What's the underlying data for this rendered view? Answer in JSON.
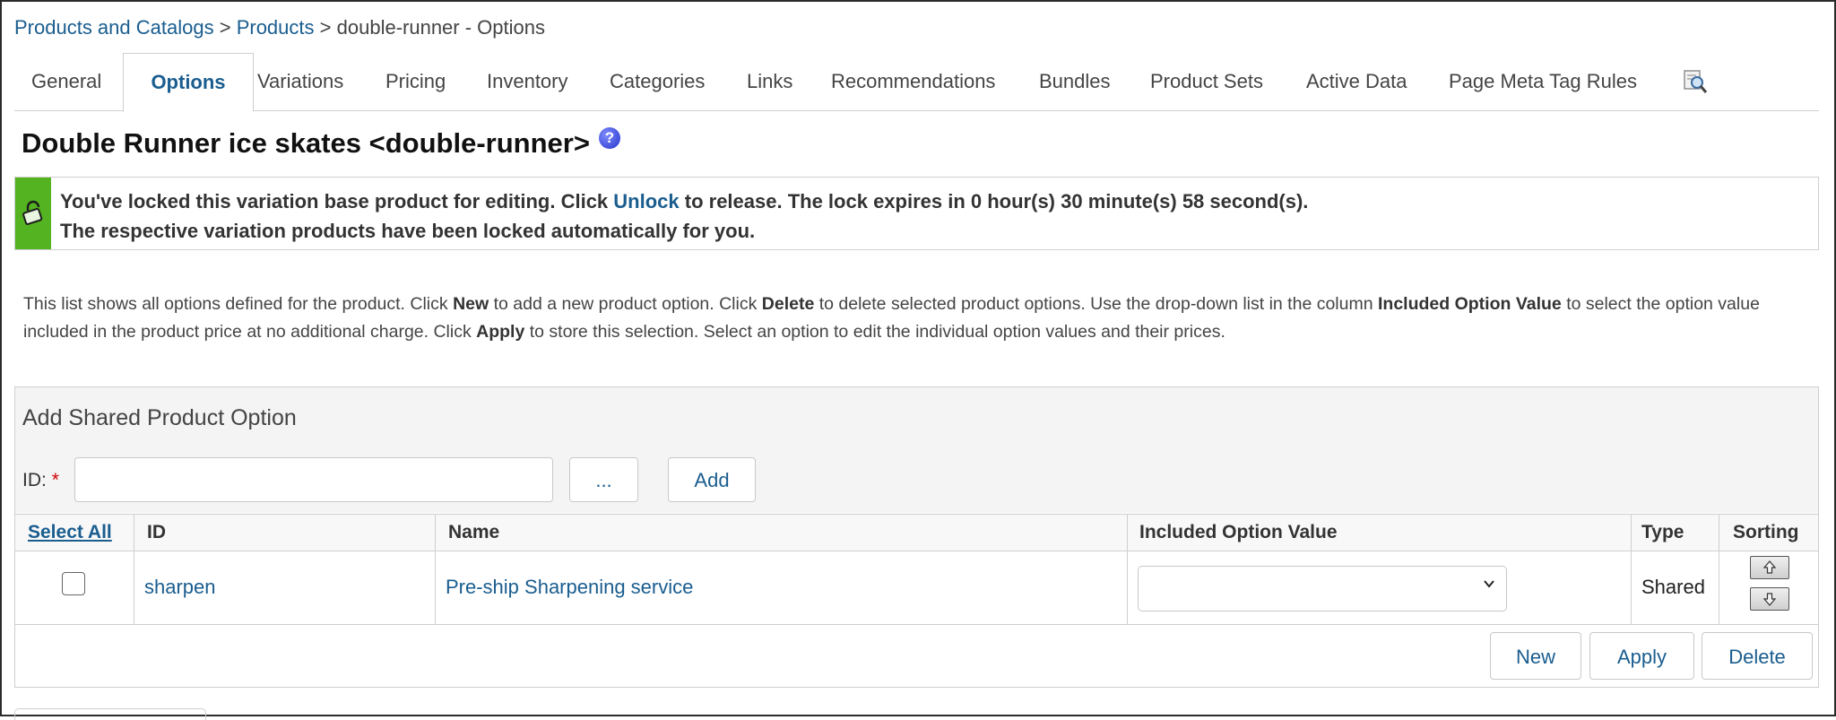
{
  "breadcrumb": {
    "root": "Products and Catalogs",
    "sep1": ">",
    "products": "Products",
    "sep2": ">",
    "current": "double-runner - Options"
  },
  "tabs": [
    {
      "label": "General"
    },
    {
      "label": "Options",
      "active": true
    },
    {
      "label": "Variations"
    },
    {
      "label": "Pricing"
    },
    {
      "label": "Inventory"
    },
    {
      "label": "Categories"
    },
    {
      "label": "Links"
    },
    {
      "label": "Recommendations"
    },
    {
      "label": "Bundles"
    },
    {
      "label": "Product Sets"
    },
    {
      "label": "Active Data"
    },
    {
      "label": "Page Meta Tag Rules"
    }
  ],
  "page": {
    "title": "Double Runner ice skates <double-runner>",
    "help_icon": "?"
  },
  "lock_message": {
    "line1_before": "You've locked this variation base product for editing. Click ",
    "unlock_link": "Unlock",
    "line1_after": " to release. The lock expires in 0 hour(s) 30 minute(s) 58 second(s).",
    "line2": "The respective variation products have been locked automatically for you."
  },
  "description": {
    "p1": "This list shows all options defined for the product. Click ",
    "b1": "New",
    "p2": " to add a new product option. Click ",
    "b2": "Delete",
    "p3": " to delete selected product options. Use the drop-down list in the column ",
    "b3": "Included Option Value",
    "p4": " to select the option value included in the product price at no additional charge. Click ",
    "b4": "Apply",
    "p5": " to store this selection. Select an option to edit the individual option values and their prices."
  },
  "shared_option": {
    "title": "Add Shared Product Option",
    "id_label": "ID:",
    "required_mark": "*",
    "id_value": "",
    "browse_label": "...",
    "add_label": "Add"
  },
  "table": {
    "headers": {
      "select_all": "Select All",
      "id": "ID",
      "name": "Name",
      "included": "Included Option Value",
      "type": "Type",
      "sorting": "Sorting"
    },
    "rows": [
      {
        "id": "sharpen",
        "name": "Pre-ship Sharpening service",
        "included": "",
        "type": "Shared"
      }
    ]
  },
  "actions": {
    "new": "New",
    "apply": "Apply",
    "delete": "Delete"
  },
  "colors": {
    "link": "#1a5d8f",
    "lock_green": "#53b320",
    "border": "#cfcfcf"
  },
  "icons": {
    "help": "help-icon",
    "lock": "lock-icon",
    "search": "search-icon",
    "chevron": "chevron-down-icon",
    "sort_up": "arrow-up-icon",
    "sort_down": "arrow-down-icon"
  }
}
